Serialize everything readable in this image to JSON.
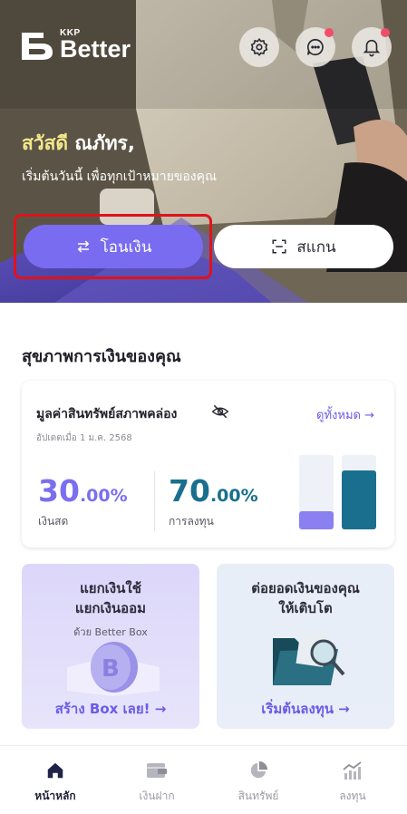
{
  "app": {
    "logo_small": "KKP",
    "logo_big": "Better"
  },
  "header_icons": [
    {
      "name": "gear-icon",
      "badge": false
    },
    {
      "name": "chat-icon",
      "badge": true
    },
    {
      "name": "bell-icon",
      "badge": true
    }
  ],
  "hero": {
    "greeting": "สวัสดี",
    "name": "ณภัทร,",
    "subtitle": "เริ่มต้นวันนี้ เพื่อทุกเป้าหมายของคุณ",
    "transfer_label": "โอนเงิน",
    "scan_label": "สแกน"
  },
  "health": {
    "title": "สุขภาพการเงินของคุณ",
    "card_title": "มูลค่าสินทรัพย์สภาพคล่อง",
    "view_all": "ดูทั้งหมด",
    "updated": "อัปเดตเมื่อ 1 ม.ค. 2568",
    "cash_value": "30",
    "cash_decimal": ".00%",
    "cash_label": "เงินสด",
    "invest_value": "70",
    "invest_decimal": ".00%",
    "invest_label": "การลงทุน",
    "cash_share": 0.3,
    "invest_share": 0.7
  },
  "promos": {
    "left_title_1": "แยกเงินใช้",
    "left_title_2": "แยกเงินออม",
    "left_sub": "ด้วย Better Box",
    "left_link": "สร้าง Box เลย! →",
    "right_title_1": "ต่อยอดเงินของคุณ",
    "right_title_2": "ให้เติบโต",
    "right_link": "เริ่มต้นลงทุน →"
  },
  "tabs": [
    {
      "label": "หน้าหลัก",
      "icon": "home-icon",
      "active": true
    },
    {
      "label": "เงินฝาก",
      "icon": "wallet-icon",
      "active": false
    },
    {
      "label": "สินทรัพย์",
      "icon": "pie-chart-icon",
      "active": false
    },
    {
      "label": "ลงทุน",
      "icon": "growth-chart-icon",
      "active": false
    }
  ],
  "colors": {
    "accent": "#7a6cf0",
    "invest": "#1a6f8e",
    "cash_bar": "#8a80f2",
    "badge": "#f04d6a",
    "highlight": "#e0121c"
  }
}
